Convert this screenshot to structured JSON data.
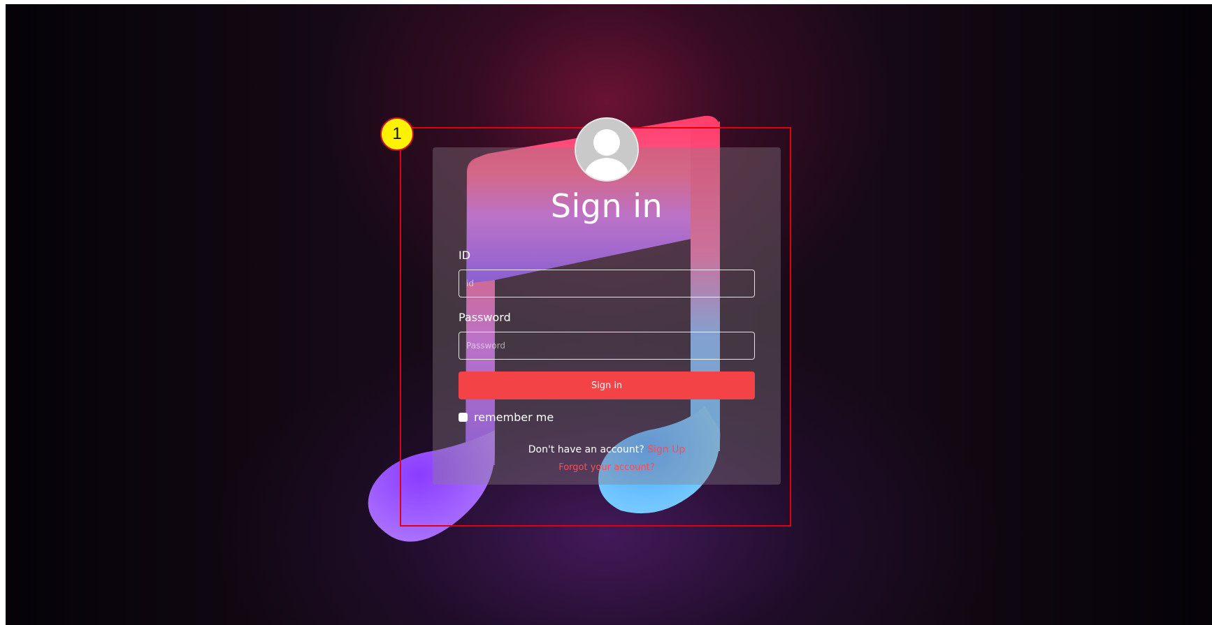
{
  "login": {
    "title": "Sign in",
    "id_label": "ID",
    "id_placeholder": "id",
    "password_label": "Password",
    "password_placeholder": "Password",
    "submit_label": "Sign in",
    "remember_label": "remember me",
    "no_account_text": "Don't have an account?",
    "signup_link": "Sign Up",
    "forgot_link": "Forgot your account?"
  },
  "annotation": {
    "badge_number": "1"
  },
  "icons": [
    "avatar-icon",
    "music-note-icon",
    "checkbox-icon"
  ],
  "colors": {
    "accent": "#f44347",
    "link": "#ff4b55",
    "annotation_border": "#e0000f",
    "annotation_badge": "#fff200"
  }
}
